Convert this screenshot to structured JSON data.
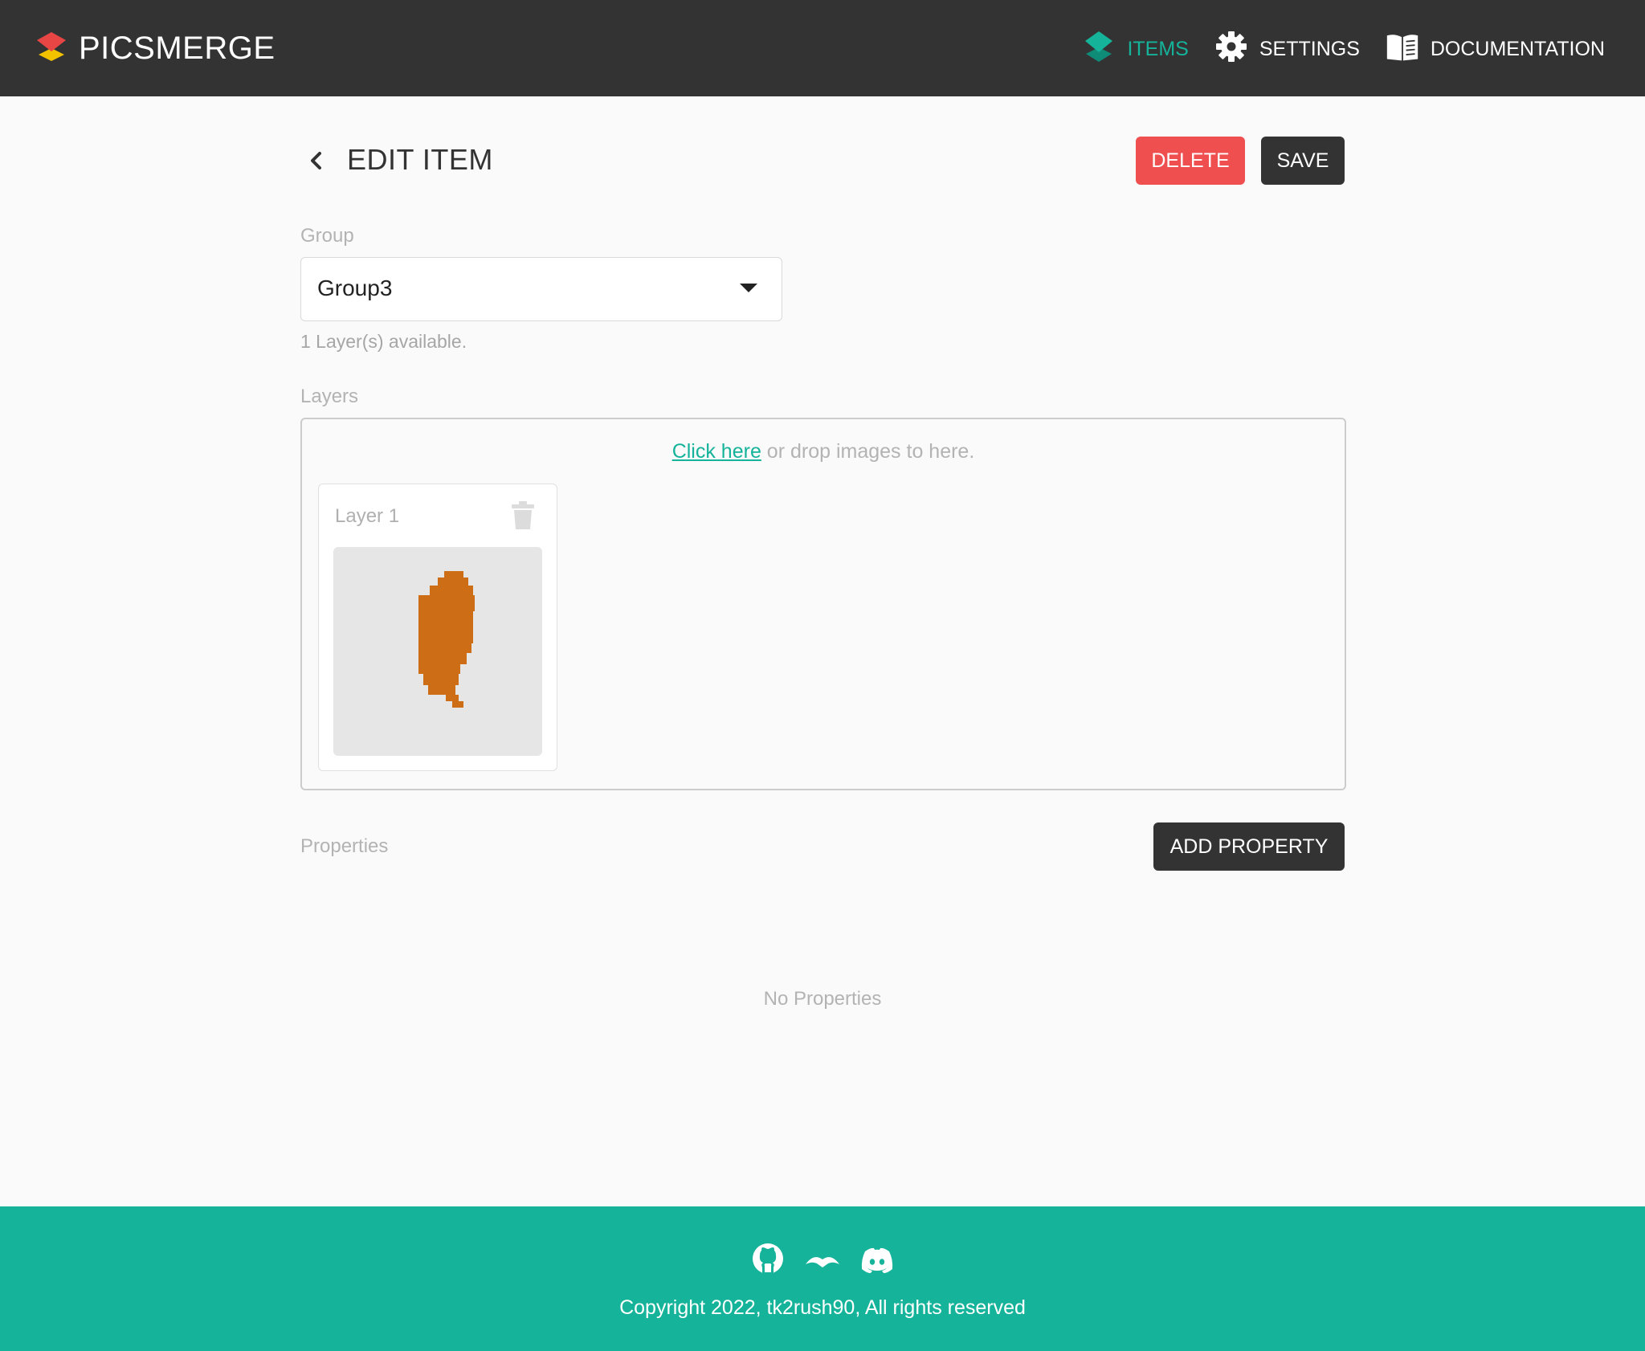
{
  "header": {
    "brand": "PICSMERGE",
    "nav": [
      {
        "label": "ITEMS",
        "icon": "layers-icon",
        "active": true
      },
      {
        "label": "SETTINGS",
        "icon": "gear-icon",
        "active": false
      },
      {
        "label": "DOCUMENTATION",
        "icon": "book-icon",
        "active": false
      }
    ]
  },
  "page": {
    "title": "EDIT ITEM",
    "delete_label": "DELETE",
    "save_label": "SAVE"
  },
  "group": {
    "label": "Group",
    "value": "Group3",
    "hint": "1 Layer(s) available."
  },
  "layers": {
    "label": "Layers",
    "upload_link": "Click here",
    "upload_text": " or drop images to here.",
    "items": [
      {
        "name": "Layer 1",
        "thumbnail": "orange-pixel-leaf-image"
      }
    ]
  },
  "properties": {
    "label": "Properties",
    "add_label": "ADD PROPERTY",
    "empty_text": "No Properties"
  },
  "footer": {
    "social": [
      "github-icon",
      "opensea-icon",
      "discord-icon"
    ],
    "copyright": "Copyright 2022, tk2rush90, All rights reserved"
  },
  "colors": {
    "header_bg": "#333333",
    "accent": "#15b39a",
    "danger": "#ef4f4f",
    "dark_button": "#333333",
    "leaf": "#cd6e17"
  }
}
